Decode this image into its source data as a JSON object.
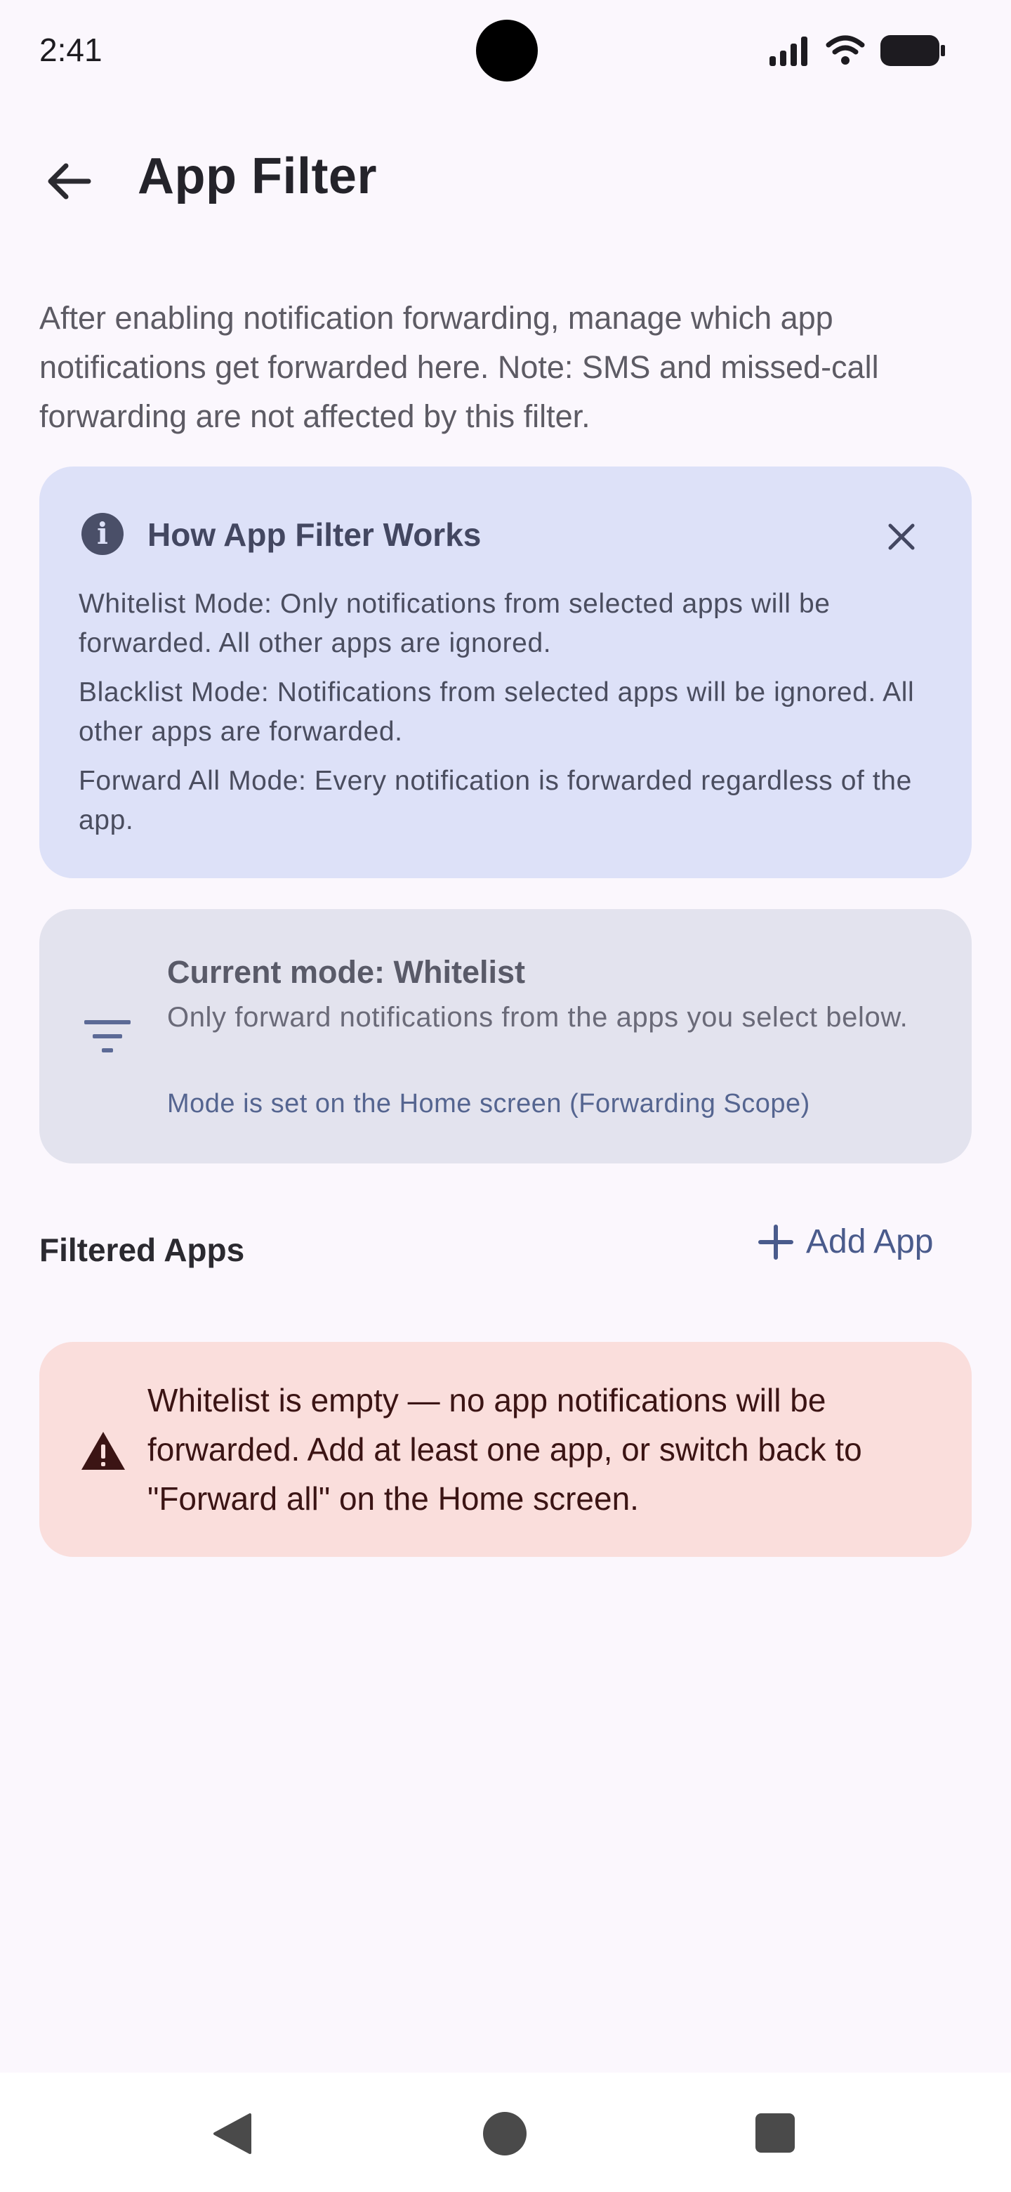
{
  "status_bar": {
    "time": "2:41"
  },
  "app_bar": {
    "title": "App Filter"
  },
  "description": "After enabling notification forwarding, manage which app notifications get forwarded here. Note: SMS and missed-call forwarding are not affected by this filter.",
  "info_card": {
    "title": "How App Filter Works",
    "lines": [
      "Whitelist Mode: Only notifications from selected apps will be forwarded. All other apps are ignored.",
      "Blacklist Mode: Notifications from selected apps will be ignored. All other apps are forwarded.",
      "Forward All Mode: Every notification is forwarded regardless of the app."
    ]
  },
  "mode_card": {
    "title": "Current mode: Whitelist",
    "subtitle": "Only forward notifications from the apps you select below.",
    "note": "Mode is set on the Home screen (Forwarding Scope)"
  },
  "filtered_apps": {
    "label": "Filtered Apps",
    "add_label": "Add App"
  },
  "warning": {
    "text": "Whitelist is empty — no app notifications will be forwarded. Add at least one app, or switch back to \"Forward all\" on the Home screen."
  },
  "icons": {
    "back": "arrow-back-icon",
    "info": "info-icon",
    "close": "close-icon",
    "filter": "filter-icon",
    "add": "plus-icon",
    "warning": "warning-triangle-icon"
  },
  "colors": {
    "background": "#fbf7fd",
    "info_card": "#dde1f8",
    "mode_card": "#e3e3ee",
    "warning_card": "#fadedc",
    "accent": "#4a5b8c"
  }
}
